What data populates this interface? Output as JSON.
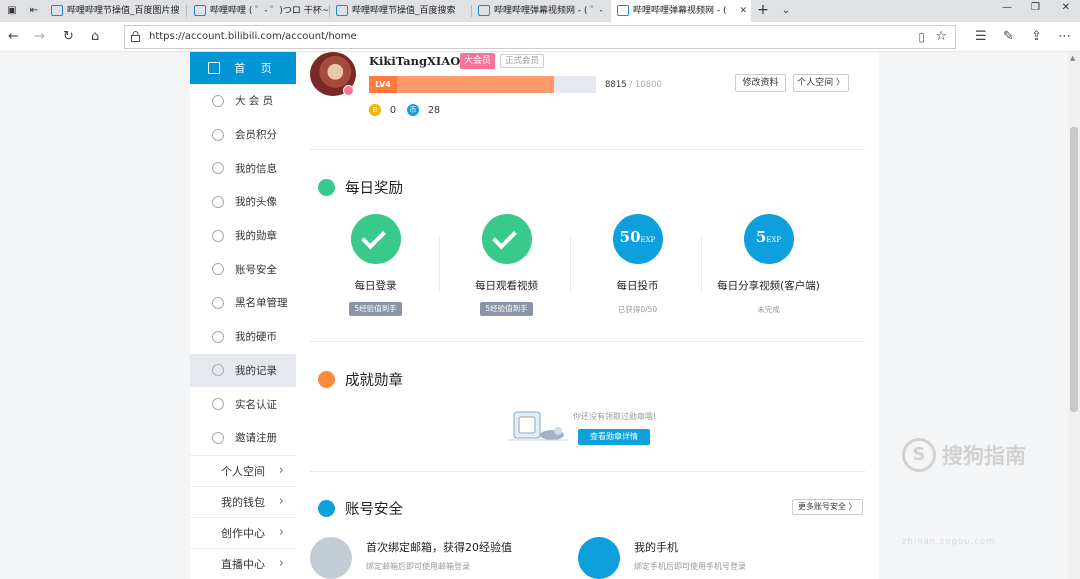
{
  "tabs": [
    {
      "title": "哔哩哔哩节操值_百度图片搜"
    },
    {
      "title": "哔哩哔哩 ( ゜- ゜)つロ 干杯~"
    },
    {
      "title": "哔哩哔哩节操值_百度搜索"
    },
    {
      "title": "哔哩哔哩弹幕视频网 - ( ゜-"
    },
    {
      "title": "哔哩哔哩弹幕视频网 - ("
    }
  ],
  "address": {
    "url": "https://account.bilibili.com/account/home"
  },
  "sidebar": {
    "home": "首 页",
    "items": [
      {
        "label": "大 会 员"
      },
      {
        "label": "会员积分"
      },
      {
        "label": "我的信息"
      },
      {
        "label": "我的头像"
      },
      {
        "label": "我的勋章"
      },
      {
        "label": "账号安全"
      },
      {
        "label": "黑名单管理"
      },
      {
        "label": "我的硬币"
      },
      {
        "label": "我的记录"
      },
      {
        "label": "实名认证"
      },
      {
        "label": "邀请注册"
      }
    ],
    "links": [
      {
        "label": "个人空间"
      },
      {
        "label": "我的钱包"
      },
      {
        "label": "创作中心"
      },
      {
        "label": "直播中心"
      }
    ]
  },
  "profile": {
    "username": "KikiTangXIAO",
    "vip_badge": "大会员",
    "member_badge": "正式会员",
    "level": "LV4",
    "exp_current": "8815",
    "exp_total": "10800",
    "exp_progress": 0.8162,
    "edit_button": "修改资料",
    "space_button": "个人空间 〉",
    "bcoin": "0",
    "coins": "28"
  },
  "daily": {
    "title": "每日奖励",
    "items": [
      {
        "label": "每日登录",
        "tag": "5经验值到手"
      },
      {
        "label": "每日观看视频",
        "tag": "5经验值到手"
      },
      {
        "label": "每日投币",
        "exp": "50",
        "exp_unit": "EXP",
        "status": "已获得0/50"
      },
      {
        "label": "每日分享视频(客户端)",
        "exp": "5",
        "exp_unit": "EXP",
        "status": "未完成"
      }
    ]
  },
  "achievement": {
    "title": "成就勋章",
    "empty_text": "你还没有领取过勋章哦!",
    "button": "查看勋章详情"
  },
  "security": {
    "title": "账号安全",
    "more_button": "更多账号安全 〉",
    "items": [
      {
        "title": "首次绑定邮箱，获得20经验值",
        "desc": "绑定邮箱后即可使用邮箱登录"
      },
      {
        "title": "我的手机",
        "desc": "绑定手机后即可使用手机号登录"
      }
    ]
  },
  "watermark": {
    "brand": "搜狗指南",
    "url": "zhinan.sogou.com"
  },
  "colors": {
    "bili_blue": "#0095d5",
    "pink": "#fb7299",
    "green": "#38c98b",
    "orange": "#ff9b6a"
  }
}
